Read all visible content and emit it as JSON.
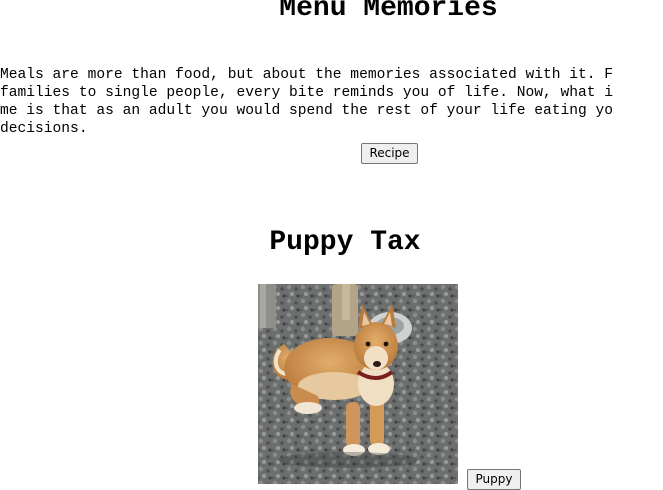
{
  "page": {
    "title": "Menu Memories"
  },
  "intro": {
    "lines": [
      "Meals are more than food, but about the memories associated with it. F",
      "families to single people, every bite reminds you of life. Now, what i",
      "me is that as an adult you would spend the rest of your life eating yo",
      "decisions."
    ]
  },
  "buttons": {
    "recipe_label": "Recipe",
    "puppy_label": "Puppy"
  },
  "puppy_section": {
    "title": "Puppy Tax",
    "photo_subject": "shiba inu dog lying on gravel"
  },
  "colors": {
    "text": "#000000",
    "background": "#ffffff",
    "button_face": "#efefef",
    "button_border": "#767676"
  }
}
